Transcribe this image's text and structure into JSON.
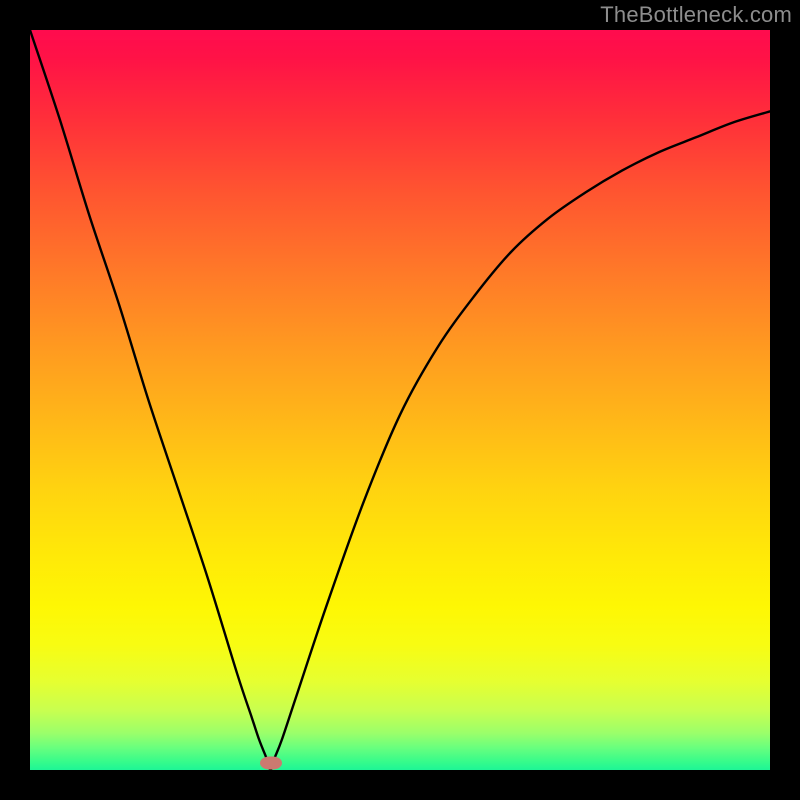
{
  "watermark": "TheBottleneck.com",
  "frame": {
    "inset": 30,
    "size": 740
  },
  "chart_data": {
    "type": "line",
    "title": "",
    "xlabel": "",
    "ylabel": "",
    "xlim": [
      0,
      100
    ],
    "ylim": [
      0,
      100
    ],
    "grid": false,
    "notch": {
      "x": 32.5,
      "y": 0
    },
    "series": [
      {
        "name": "bottleneck-curve",
        "x": [
          0,
          4,
          8,
          12,
          16,
          20,
          24,
          28,
          30,
          31,
          32,
          32.5,
          33,
          34,
          36,
          40,
          45,
          50,
          55,
          60,
          65,
          70,
          75,
          80,
          85,
          90,
          95,
          100
        ],
        "values": [
          100,
          88,
          75,
          63,
          50,
          38,
          26,
          13,
          7,
          4,
          1.5,
          0,
          1.5,
          4,
          10,
          22,
          36,
          48,
          57,
          64,
          70,
          74.5,
          78,
          81,
          83.5,
          85.5,
          87.5,
          89
        ]
      }
    ],
    "gradient_stops": [
      {
        "pos": 0,
        "color": "#ff0b4e"
      },
      {
        "pos": 50,
        "color": "#ffb818"
      },
      {
        "pos": 80,
        "color": "#fef704"
      },
      {
        "pos": 100,
        "color": "#1ef596"
      }
    ],
    "marker": {
      "x": 32.5,
      "y": 1.0,
      "color": "#cb7a70"
    }
  }
}
